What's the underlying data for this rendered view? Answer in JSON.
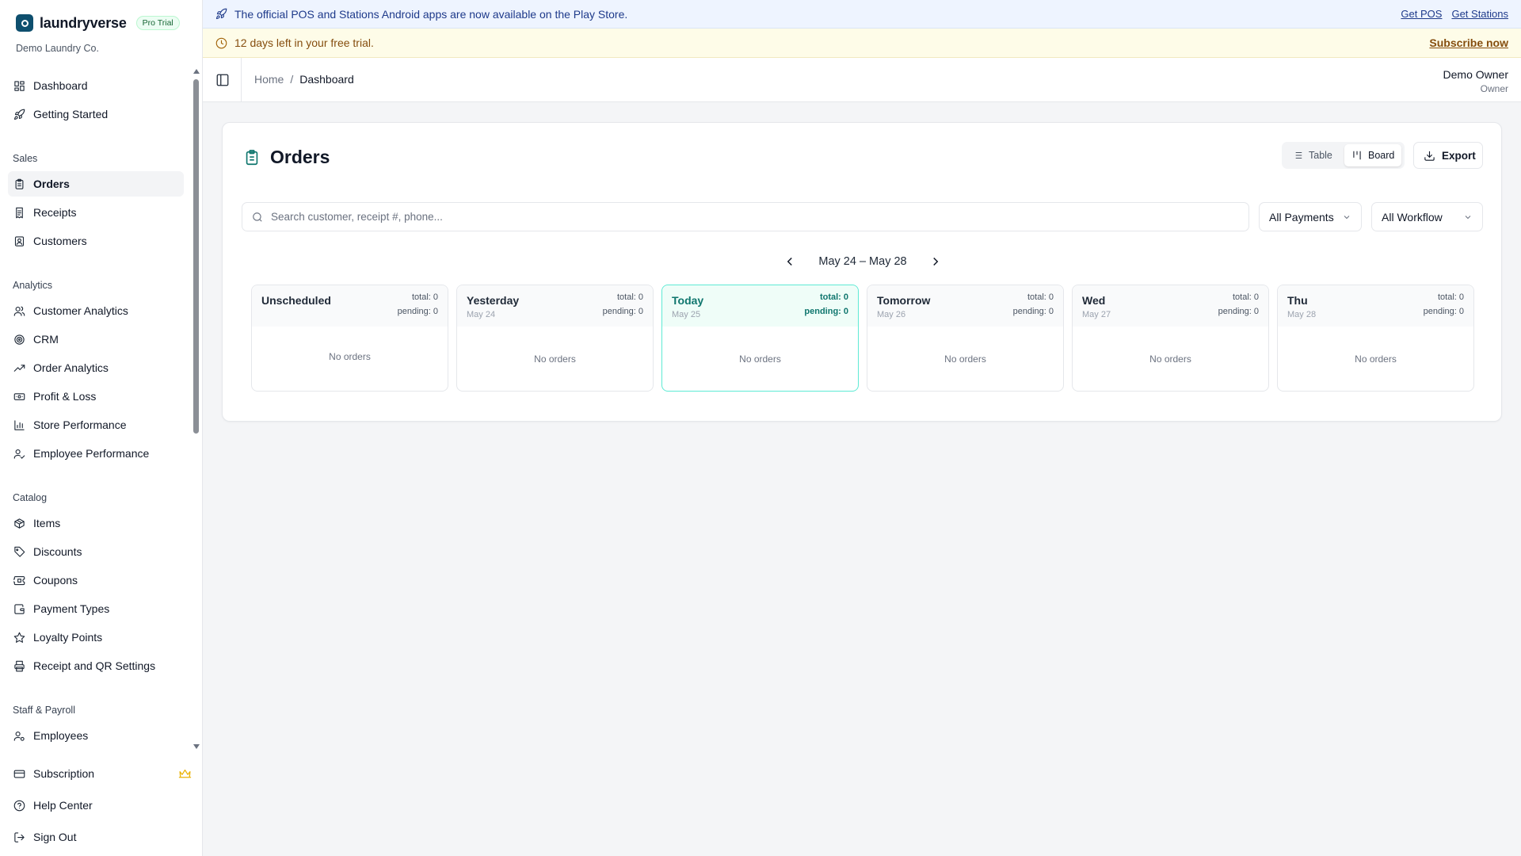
{
  "brand": {
    "name": "laundryverse",
    "badge": "Pro Trial",
    "company": "Demo Laundry Co."
  },
  "sidebar": {
    "top_items": [
      {
        "label": "Dashboard",
        "icon": "dashboard-icon"
      },
      {
        "label": "Getting Started",
        "icon": "rocket-icon"
      }
    ],
    "groups": [
      {
        "title": "Sales",
        "items": [
          {
            "label": "Orders",
            "icon": "clipboard-icon",
            "active": true
          },
          {
            "label": "Receipts",
            "icon": "receipt-icon"
          },
          {
            "label": "Customers",
            "icon": "contact-icon"
          }
        ]
      },
      {
        "title": "Analytics",
        "items": [
          {
            "label": "Customer Analytics",
            "icon": "users-icon"
          },
          {
            "label": "CRM",
            "icon": "target-icon"
          },
          {
            "label": "Order Analytics",
            "icon": "trending-up-icon"
          },
          {
            "label": "Profit & Loss",
            "icon": "banknote-icon"
          },
          {
            "label": "Store Performance",
            "icon": "bar-chart-icon"
          },
          {
            "label": "Employee Performance",
            "icon": "user-check-icon"
          }
        ]
      },
      {
        "title": "Catalog",
        "items": [
          {
            "label": "Items",
            "icon": "package-icon"
          },
          {
            "label": "Discounts",
            "icon": "tag-icon"
          },
          {
            "label": "Coupons",
            "icon": "ticket-icon"
          },
          {
            "label": "Payment Types",
            "icon": "wallet-icon"
          },
          {
            "label": "Loyalty Points",
            "icon": "star-icon"
          },
          {
            "label": "Receipt and QR Settings",
            "icon": "printer-icon"
          }
        ]
      },
      {
        "title": "Staff & Payroll",
        "items": [
          {
            "label": "Employees",
            "icon": "user-cog-icon"
          }
        ]
      }
    ],
    "footer": [
      {
        "label": "Subscription",
        "icon": "credit-card-icon"
      },
      {
        "label": "Help Center",
        "icon": "help-circle-icon"
      },
      {
        "label": "Sign Out",
        "icon": "log-out-icon"
      }
    ]
  },
  "banners": {
    "announcement": "The official POS and Stations Android apps are now available on the Play Store.",
    "get_pos": "Get POS",
    "get_stations": "Get Stations",
    "trial": "12 days left in your free trial.",
    "subscribe": "Subscribe now"
  },
  "header": {
    "breadcrumb_home": "Home",
    "breadcrumb_sep": "/",
    "breadcrumb_current": "Dashboard",
    "user_name": "Demo Owner",
    "user_role": "Owner"
  },
  "orders": {
    "title": "Orders",
    "view_table": "Table",
    "view_board": "Board",
    "export": "Export",
    "search_placeholder": "Search customer, receipt #, phone...",
    "payments_filter": "All Payments",
    "workflow_filter": "All Workflow",
    "date_range": "May 24 – May 28",
    "columns": [
      {
        "name": "Unscheduled",
        "date": "",
        "total": "total: 0",
        "pending": "pending: 0",
        "empty": "No orders"
      },
      {
        "name": "Yesterday",
        "date": "May 24",
        "total": "total: 0",
        "pending": "pending: 0",
        "empty": "No orders"
      },
      {
        "name": "Today",
        "date": "May 25",
        "total": "total: 0",
        "pending": "pending: 0",
        "empty": "No orders"
      },
      {
        "name": "Tomorrow",
        "date": "May 26",
        "total": "total: 0",
        "pending": "pending: 0",
        "empty": "No orders"
      },
      {
        "name": "Wed",
        "date": "May 27",
        "total": "total: 0",
        "pending": "pending: 0",
        "empty": "No orders"
      },
      {
        "name": "Thu",
        "date": "May 28",
        "total": "total: 0",
        "pending": "pending: 0",
        "empty": "No orders"
      }
    ]
  },
  "colors": {
    "accent": "#0f766e",
    "brand": "#0e4f6e",
    "crown": "#eab308"
  }
}
